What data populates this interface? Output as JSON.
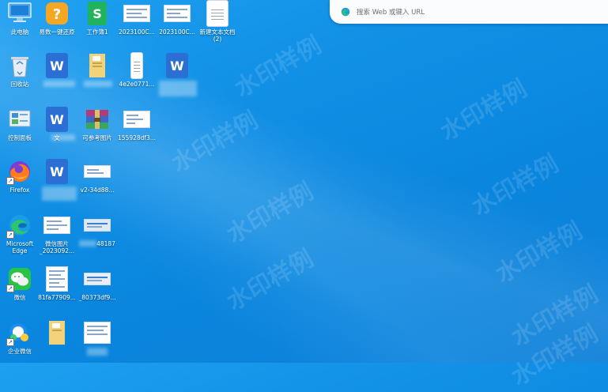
{
  "search": {
    "placeholder": "搜索 Web 或键入 URL",
    "icon": "edge-icon"
  },
  "watermark": "水印样例",
  "icons": [
    {
      "id": "this-pc",
      "label": "此电脑",
      "kind": "pc-icon"
    },
    {
      "id": "yijian-restore",
      "label": "易数一键还原",
      "kind": "restore-app-icon"
    },
    {
      "id": "work-book",
      "label": "工作簿1",
      "kind": "spreadsheet-icon"
    },
    {
      "id": "img-2023100a",
      "label": "2023100C...",
      "kind": "image-thumbnail-icon"
    },
    {
      "id": "img-2023100b",
      "label": "2023100C...",
      "kind": "image-thumbnail-icon"
    },
    {
      "id": "new-text",
      "label": "新建文本文档\n(2)",
      "kind": "text-file-icon"
    },
    {
      "id": "recycle-bin",
      "label": "回收站",
      "kind": "recycle-bin-icon"
    },
    {
      "id": "word-doc-1",
      "label": "",
      "kind": "word-doc-icon"
    },
    {
      "id": "folder-1",
      "label": "",
      "kind": "folder-icon"
    },
    {
      "id": "file-4e2e",
      "label": "4e2e0771...",
      "kind": "text-file-icon"
    },
    {
      "id": "word-doc-2",
      "label": "",
      "kind": "word-doc-icon"
    },
    {
      "id": "control-panel",
      "label": "控制面板",
      "kind": "control-panel-icon"
    },
    {
      "id": "word-doc-3",
      "label": "文",
      "kind": "word-doc-icon"
    },
    {
      "id": "rar-archive",
      "label": "可参考图片",
      "kind": "archive-icon"
    },
    {
      "id": "img-155928",
      "label": "155928df3...",
      "kind": "image-thumbnail-icon"
    },
    {
      "id": "firefox",
      "label": "Firefox",
      "kind": "firefox-icon"
    },
    {
      "id": "word-doc-4",
      "label": "",
      "kind": "word-doc-icon"
    },
    {
      "id": "img-v2-34d",
      "label": "v2-34d88...",
      "kind": "image-thumbnail-icon"
    },
    {
      "id": "edge",
      "label": "Microsoft\nEdge",
      "kind": "edge-icon"
    },
    {
      "id": "img-wechat",
      "label": "微信图片\n_2023092...",
      "kind": "image-thumbnail-icon"
    },
    {
      "id": "img-48187",
      "label": "48187",
      "kind": "image-thumbnail-icon"
    },
    {
      "id": "wechat",
      "label": "微信",
      "kind": "wechat-icon"
    },
    {
      "id": "img-81fa",
      "label": "81fa77909...",
      "kind": "image-thumbnail-icon"
    },
    {
      "id": "img-80373",
      "label": "_80373df9...",
      "kind": "image-thumbnail-icon"
    },
    {
      "id": "wecom",
      "label": "企业微信",
      "kind": "wecom-icon"
    },
    {
      "id": "folder-2",
      "label": "",
      "kind": "folder-icon"
    },
    {
      "id": "img-bottom",
      "label": "",
      "kind": "image-thumbnail-icon"
    }
  ],
  "colors": {
    "desktop_bg": "#0a86de",
    "word_blue": "#2b6fd4",
    "folder_yellow": "#f5cf62"
  }
}
